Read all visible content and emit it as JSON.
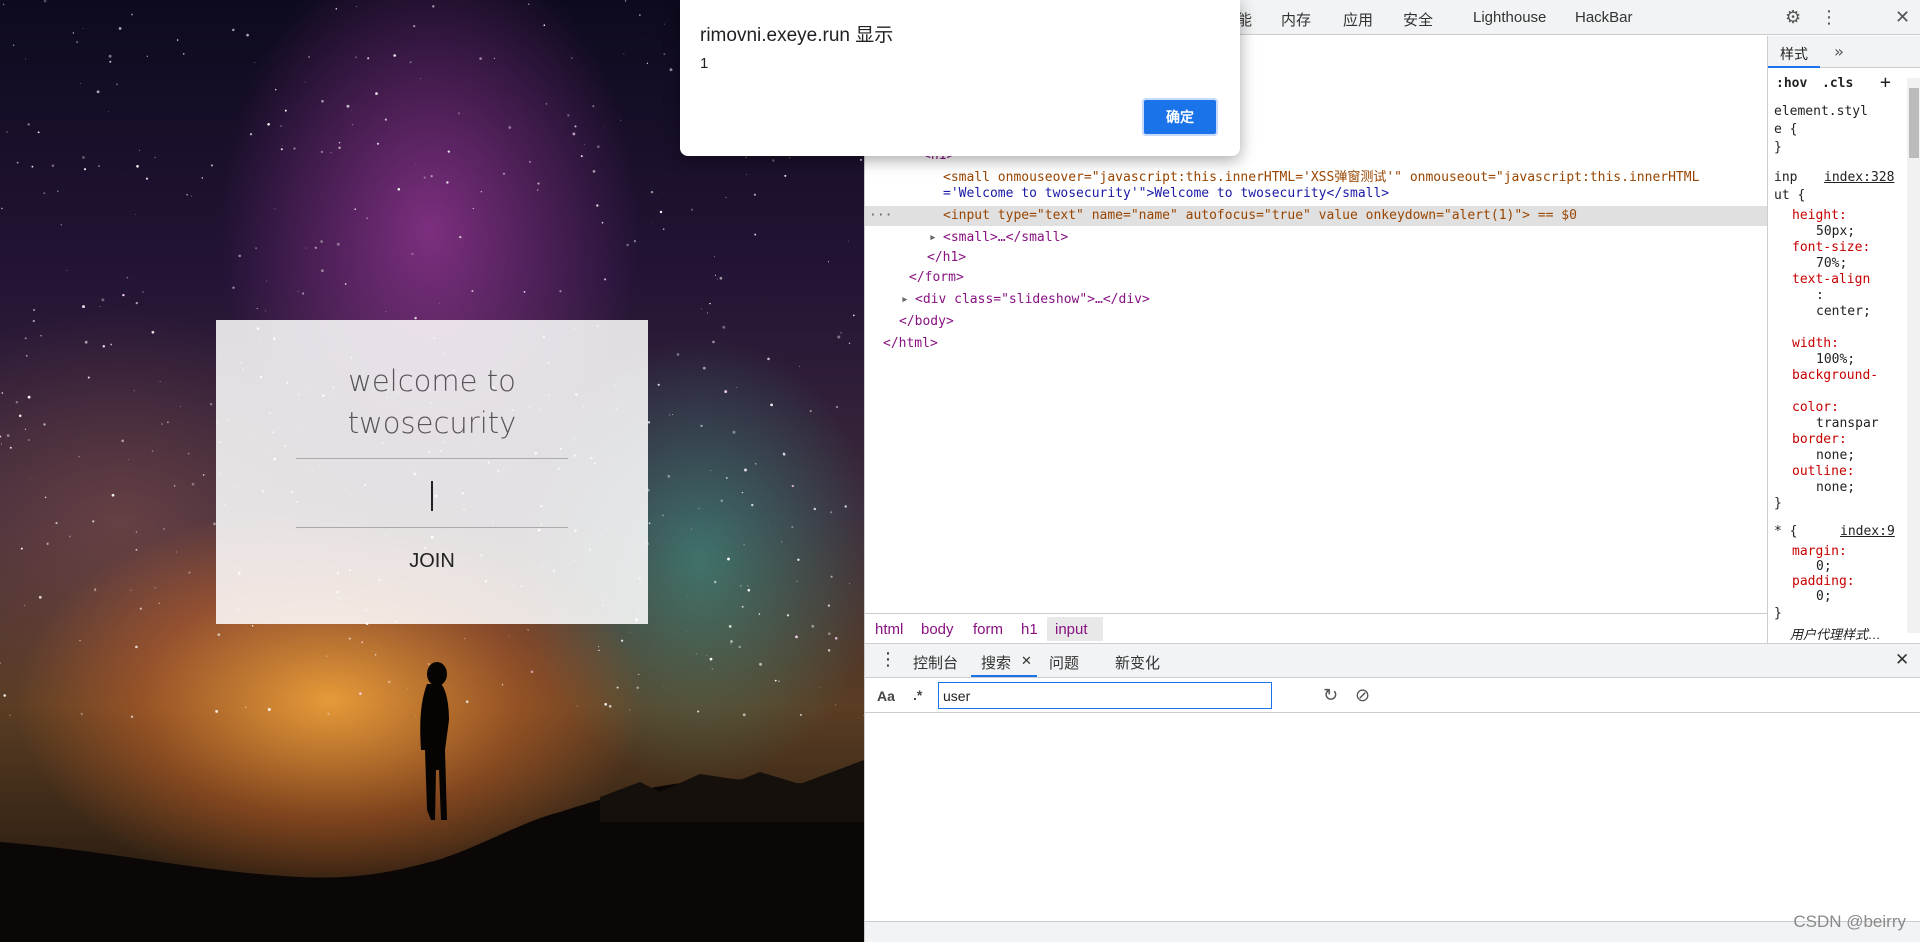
{
  "page": {
    "welcome_line1": "welcome to",
    "welcome_line2": "twosecurity",
    "join_label": "JOIN"
  },
  "alert": {
    "title": "rimovni.exeye.run 显示",
    "message": "1",
    "ok_label": "确定"
  },
  "devtools": {
    "top_tabs": [
      "能",
      "内存",
      "应用",
      "安全",
      "Lighthouse",
      "HackBar"
    ],
    "elements": {
      "line_small_open": "<small onmouseover=\"javascript:this.innerHTML='XSS弹窗测试'\" onmouseout=\"javascript:this.innerHTML",
      "line_small_cont": "='Welcome to twosecurity'\">Welcome to twosecurity</small>",
      "line_input": "<input type=\"text\" name=\"name\" autofocus=\"true\" value onkeydown=\"alert(1)\"> == $0",
      "line_small_collapsed": "<small>…</small>",
      "line_h1_close": "</h1>",
      "line_form_close": "</form>",
      "line_div": "<div class=\"slideshow\">…</div>",
      "line_body_close": "</body>",
      "line_html_close": "</html>",
      "line_h1_partial": "<h1>",
      "ellipsis": "···"
    },
    "breadcrumbs": [
      "html",
      "body",
      "form",
      "h1",
      "input"
    ],
    "styles": {
      "tab_label": "样式",
      "hov": ":hov",
      "cls": ".cls",
      "element_style_1": "element.styl",
      "element_style_2": "e {",
      "close_brace": "}",
      "rule1_selector_1": "inp",
      "rule1_selector_2": "ut {",
      "rule1_link": "index:328",
      "rule1_props": [
        [
          "height:",
          "50px;"
        ],
        [
          "font-size:",
          "70%;"
        ],
        [
          "text-align",
          ":"
        ],
        [
          "",
          "center;"
        ],
        [
          "width:",
          "100%;"
        ],
        [
          "background-",
          ""
        ],
        [
          "color:",
          "transpar"
        ],
        [
          "border:",
          "none;"
        ],
        [
          "outline:",
          "none;"
        ]
      ],
      "rule2_selector": "* {",
      "rule2_link": "index:9",
      "rule2_props": [
        [
          "margin:",
          "0;"
        ],
        [
          "padding:",
          "0;"
        ]
      ],
      "user_agent": "用户代理样式…"
    },
    "drawer": {
      "tabs": [
        "控制台",
        "搜索",
        "问题",
        "新变化"
      ],
      "aa": "Aa",
      "regex": ".*",
      "search_value": "user"
    }
  },
  "watermark": "CSDN @beirry"
}
